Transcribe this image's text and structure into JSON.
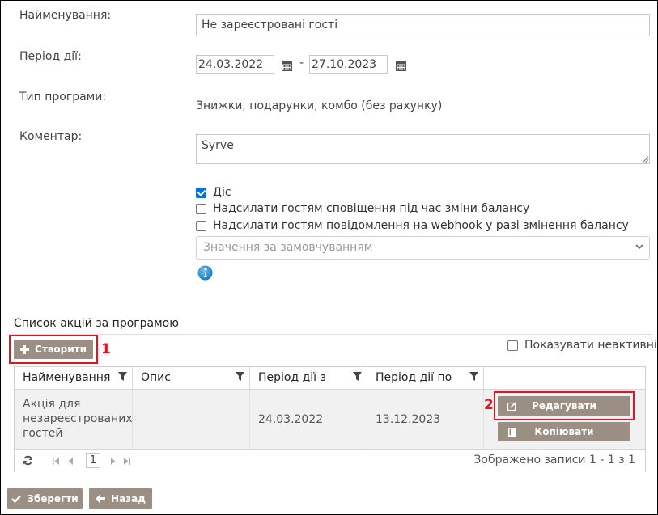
{
  "form": {
    "name_label": "Найменування:",
    "name_value": "Не зареєстровані гості",
    "period_label": "Період дії:",
    "date_from": "24.03.2022",
    "date_sep": "-",
    "date_to": "27.10.2023",
    "program_type_label": "Тип програми:",
    "program_type_value": "Знижки, подарунки, комбо (без рахунку)",
    "comment_label": "Коментар:",
    "comment_value": "Syrve",
    "checkboxes": [
      {
        "label": "Діє",
        "checked": true
      },
      {
        "label": "Надсилати гостям сповіщення під час зміни балансу",
        "checked": false
      },
      {
        "label": "Надсилати гостям повідомлення на webhook у разі змінення балансу",
        "checked": false
      }
    ],
    "select_placeholder": "Значення за замовчуванням"
  },
  "actions_section": {
    "title": "Список акцій за програмою",
    "create_label": "Створити",
    "show_inactive_label": "Показувати неактивні",
    "marker_1": "1",
    "marker_2": "2",
    "columns": [
      "Найменування",
      "Опис",
      "Період дії з",
      "Період дії по"
    ],
    "rows": [
      {
        "name": "Акція для незареєстрованих гостей",
        "description": "",
        "from": "24.03.2022",
        "to": "13.12.2023",
        "edit_label": "Редагувати",
        "copy_label": "Копіювати"
      }
    ],
    "pager": {
      "page": "1",
      "summary": "Зображено записи 1 - 1 з 1"
    }
  },
  "footer": {
    "save_label": "Зберегти",
    "back_label": "Назад"
  },
  "colors": {
    "button_bg": "#9b8e82",
    "highlight_red": "#e0151f",
    "checkbox_blue": "#0b6fd8"
  }
}
